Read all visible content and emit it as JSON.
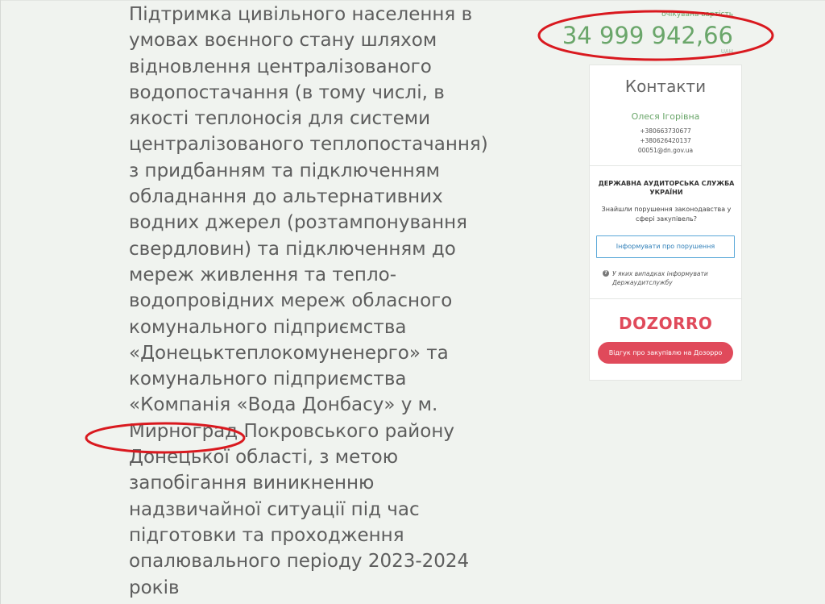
{
  "description": "Підтримка цивільного населення в\nумовах воєнного стану шляхом\nвідновлення централізованого\nводопостачання (в тому числі, в\nякості теплоносія для системи\nцентралізованого теплопостачання)\nз придбанням та підключенням\nобладнання до альтернативних\nводних джерел (розтампонування\nсвердловин) та підключенням до\nмереж живлення та тепло-\nводопровідних мереж обласного\nкомунального підприємства\n«Донецьктеплокомуненерго» та\nкомунального підприємства\n«Компанія «Вода Донбасу» у м.\nМирноград Покровського району\nДонецької області, з метою\nзапобігання виникненню\nнадзвичайної ситуації під час\nпідготовки та проходження\nопалювального періоду 2023-2024\nроків",
  "price": {
    "label": "очікувана вартість",
    "value": "34 999 942,66",
    "currency": "UAH"
  },
  "contacts": {
    "title": "Контакти",
    "person": "Олеся Ігорівна",
    "phone1": "+380663730677",
    "phone2": "+380626420137",
    "email": "00051@dn.gov.ua"
  },
  "audit": {
    "title": "ДЕРЖАВНА АУДИТОРСЬКА СЛУЖБА УКРАЇНИ",
    "question": "Знайшли порушення законодавства у сфері закупівель?",
    "button_label": "Інформувати про порушення",
    "hint_icon": "question-circle-icon",
    "hint_text": "У яких випадках інформувати Держаудитслужбу"
  },
  "dozorro": {
    "logo_text": "DOZORRO",
    "button_label": "Відгук про закупівлю на Дозорро"
  },
  "colors": {
    "background": "#f0f3ef",
    "price_green": "#6aa66a",
    "dozorro_red": "#e04a5b",
    "annotation_red": "#d9191f",
    "link_blue": "#2f7fb8"
  }
}
